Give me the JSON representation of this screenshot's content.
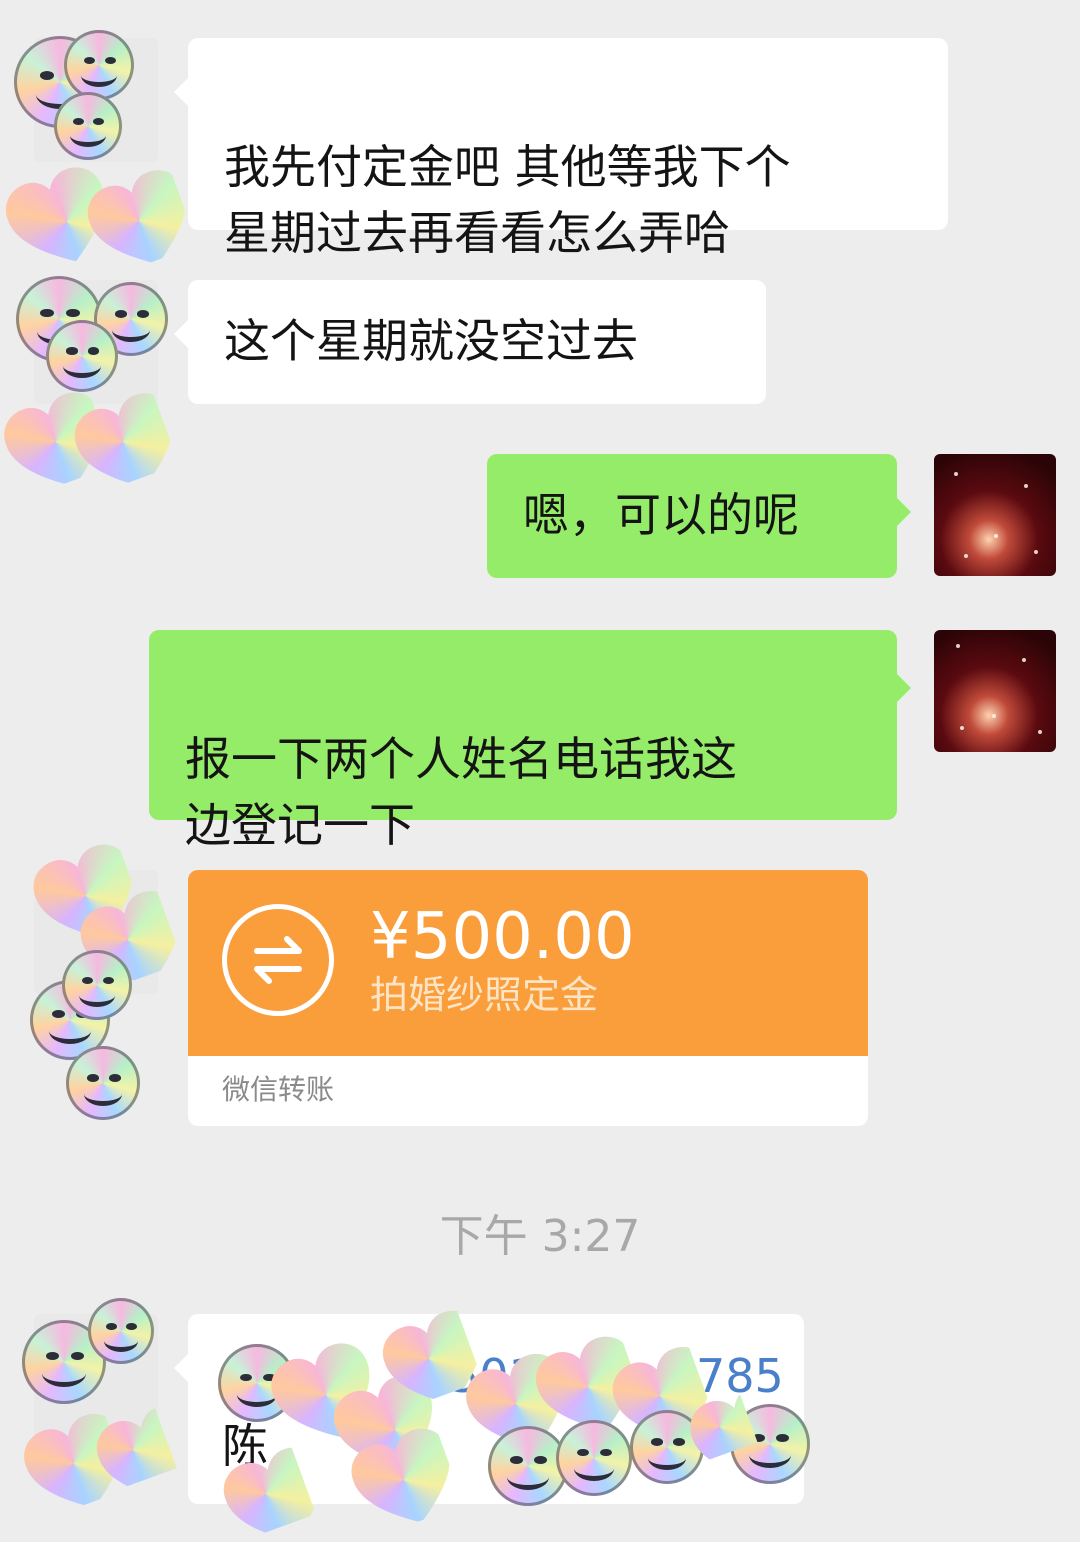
{
  "messages": [
    {
      "side": "in",
      "text": "我先付定金吧 其他等我下个\n星期过去再看看怎么弄哈"
    },
    {
      "side": "in",
      "text": "这个星期就没空过去"
    },
    {
      "side": "out",
      "text": "嗯，可以的呢"
    },
    {
      "side": "out",
      "text": "报一下两个人姓名电话我这\n边登记一下"
    }
  ],
  "transfer": {
    "amount": "¥500.00",
    "note": "拍婚纱照定金",
    "source": "微信转账",
    "icon": "transfer-arrows-icon",
    "color": "#fa9d3b"
  },
  "timestamp": "下午 3:27",
  "last_message": {
    "line1_phone": "5010",
    "line1_phone_end": "785",
    "line2_name": "陈"
  },
  "colors": {
    "background": "#ededed",
    "incoming_bubble": "#ffffff",
    "outgoing_bubble": "#95ec69",
    "transfer": "#fa9d3b"
  }
}
